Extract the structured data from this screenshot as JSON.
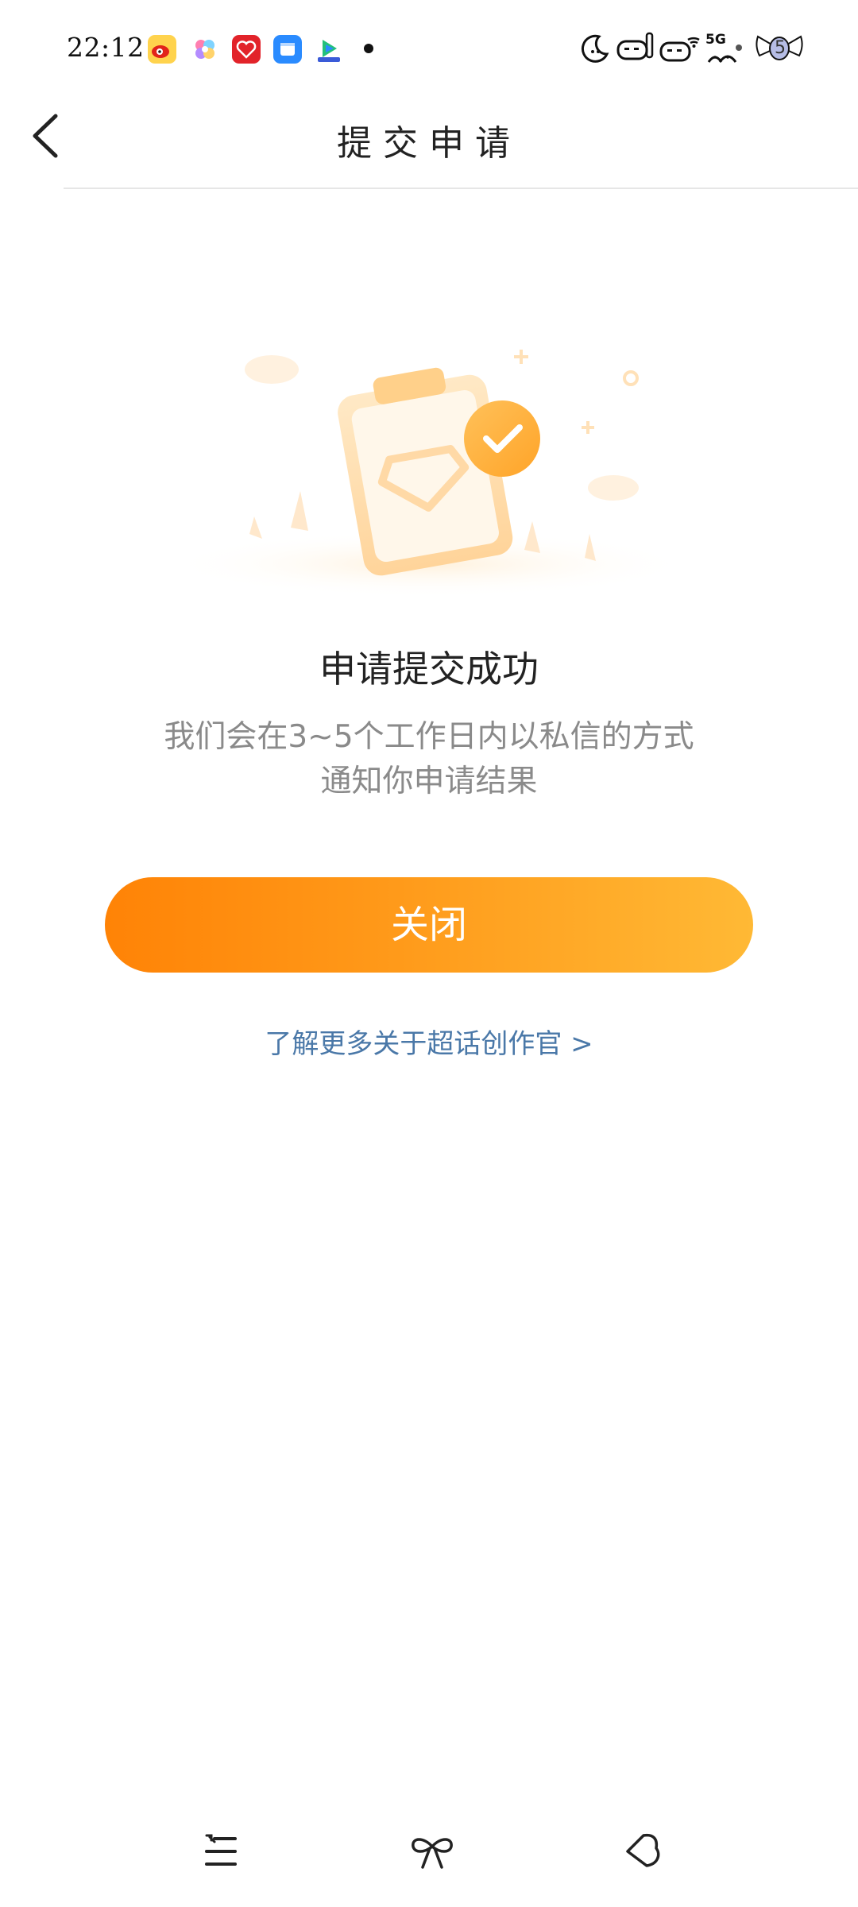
{
  "status_bar": {
    "time": "22:12",
    "network_label": "5G",
    "battery_badge": "5",
    "notification_icons": [
      "weibo-app-icon",
      "pinwheel-app-icon",
      "red-heart-app-icon",
      "blue-window-app-icon",
      "video-app-icon"
    ],
    "system_icons": [
      "moon-icon",
      "alarm-icon",
      "wifi-icon",
      "signal-icon",
      "battery-icon"
    ]
  },
  "nav": {
    "title": "提交申请",
    "back_icon": "chevron-left-icon"
  },
  "result": {
    "title": "申请提交成功",
    "desc_line1": "我们会在3~5个工作日内以私信的方式",
    "desc_line2": "通知你申请结果"
  },
  "actions": {
    "close_label": "关闭",
    "learn_more_label": "了解更多关于超话创作官 >"
  },
  "bottom_nav": {
    "items": [
      "menu-list-icon",
      "bow-icon",
      "back-diamond-icon"
    ]
  },
  "colors": {
    "accent_start": "#ff8306",
    "accent_end": "#ffb935",
    "link": "#4a78a8",
    "illustration_orange": "#ffb347"
  }
}
